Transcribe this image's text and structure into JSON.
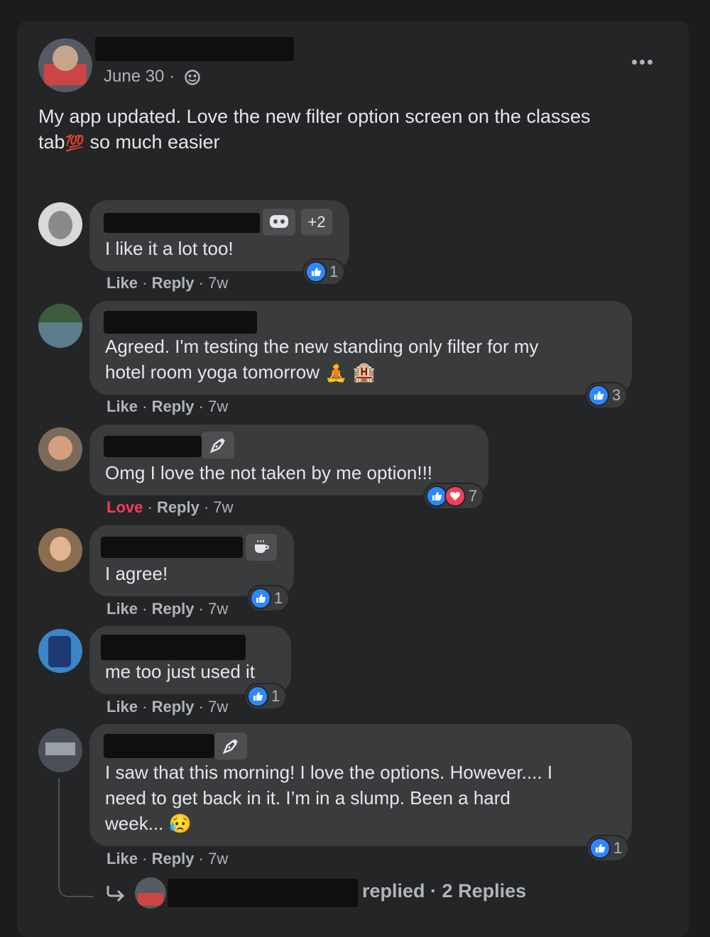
{
  "post": {
    "date": "June 30 ·",
    "text_line1": "My app updated.  Love the new filter option screen on the classes",
    "text_line2_pre": "tab",
    "text_line2_emoji": "💯",
    "text_line2_post": " so much easier"
  },
  "comments": [
    {
      "text": [
        "I like it a lot too!"
      ],
      "badge_extra": "+2",
      "action": "Like",
      "reply": "Reply",
      "age": "7w",
      "reaction_count": "1"
    },
    {
      "text": [
        "Agreed. I'm testing the new standing only filter for my",
        "hotel room yoga tomorrow 🧘 🏨"
      ],
      "action": "Like",
      "reply": "Reply",
      "age": "7w",
      "reaction_count": "3"
    },
    {
      "text": [
        "Omg I love the not taken by me option!!!"
      ],
      "action": "Love",
      "reply": "Reply",
      "age": "7w",
      "reaction_count": "7"
    },
    {
      "text": [
        "I agree!"
      ],
      "action": "Like",
      "reply": "Reply",
      "age": "7w",
      "reaction_count": "1"
    },
    {
      "text": [
        "me too just used it"
      ],
      "action": "Like",
      "reply": "Reply",
      "age": "7w",
      "reaction_count": "1"
    },
    {
      "text": [
        "I saw that this morning! I love the options. However.... I",
        "need to get back in it. I’m in a slump. Been a hard",
        "week... 😥"
      ],
      "action": "Like",
      "reply": "Reply",
      "age": "7w",
      "reaction_count": "1"
    }
  ],
  "replies_summary": {
    "verb": "replied ·",
    "count_label": "2 Replies"
  },
  "separator": "·",
  "colors": {
    "like_blue": "#2d88ff",
    "love_red": "#f33e58",
    "bubble": "#3a3b3c",
    "card": "#242526"
  },
  "icons": [
    "more-options-icon",
    "globe-privacy-icon",
    "like-reaction-icon",
    "love-reaction-icon",
    "gamer-badge-icon",
    "pen-badge-icon",
    "coffee-badge-icon",
    "reply-arrow-icon"
  ]
}
